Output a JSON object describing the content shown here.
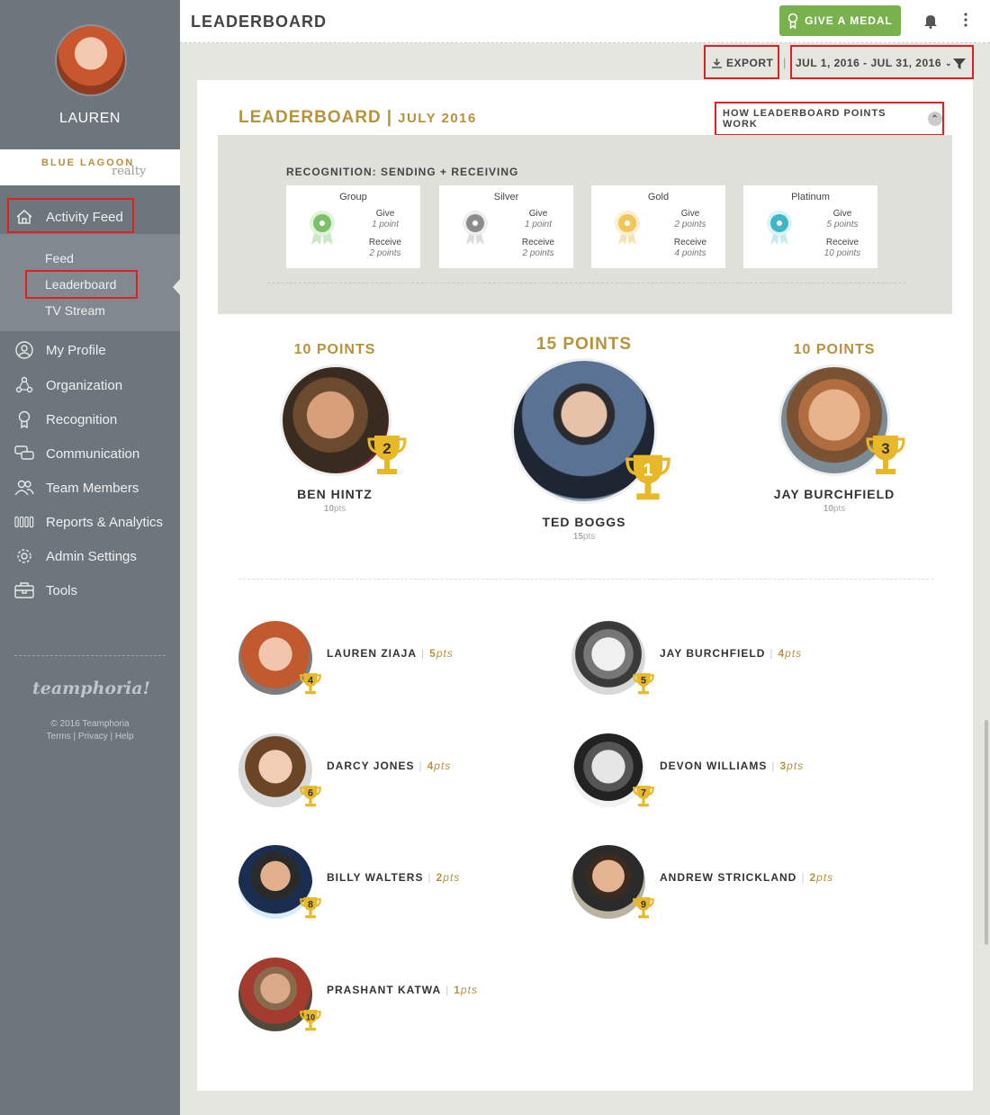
{
  "user": {
    "name": "LAUREN"
  },
  "brand": {
    "line1": "BLUE LAGOON",
    "line2": "realty"
  },
  "nav": {
    "activity_feed": "Activity Feed",
    "sub": [
      "Feed",
      "Leaderboard",
      "TV Stream"
    ],
    "items": [
      "My Profile",
      "Organization",
      "Recognition",
      "Communication",
      "Team Members",
      "Reports & Analytics",
      "Admin Settings",
      "Tools"
    ]
  },
  "footer": {
    "logo": "teamphoria!",
    "copyright": "© 2016 Teamphoria",
    "links": "Terms | Privacy | Help"
  },
  "header": {
    "title": "LEADERBOARD",
    "give_medal": "GIVE A MEDAL"
  },
  "toolbar": {
    "export": "EXPORT",
    "date_range": "JUL 1, 2016 - JUL 31, 2016"
  },
  "leaderboard": {
    "title": "LEADERBOARD",
    "month": "JULY 2016",
    "how_it_works": "HOW LEADERBOARD POINTS WORK",
    "recognition_title": "RECOGNITION: SENDING + RECEIVING",
    "medals": [
      {
        "name": "Group",
        "give_label": "Give",
        "give_points": "1 point",
        "receive_label": "Receive",
        "receive_points": "2 points",
        "color": "#7cc06a"
      },
      {
        "name": "Silver",
        "give_label": "Give",
        "give_points": "1 point",
        "receive_label": "Receive",
        "receive_points": "2 points",
        "color": "#8c8c8c"
      },
      {
        "name": "Gold",
        "give_label": "Give",
        "give_points": "2 points",
        "receive_label": "Receive",
        "receive_points": "4 points",
        "color": "#f0c55a"
      },
      {
        "name": "Platinum",
        "give_label": "Give",
        "give_points": "5 points",
        "receive_label": "Receive",
        "receive_points": "10 points",
        "color": "#3fb6c4"
      }
    ],
    "podium": [
      {
        "rank": "2",
        "points_label": "10 POINTS",
        "name": "BEN HINTZ",
        "pts_num": "10",
        "pts_unit": "pts"
      },
      {
        "rank": "1",
        "points_label": "15 POINTS",
        "name": "TED BOGGS",
        "pts_num": "15",
        "pts_unit": "pts"
      },
      {
        "rank": "3",
        "points_label": "10 POINTS",
        "name": "JAY BURCHFIELD",
        "pts_num": "10",
        "pts_unit": "pts"
      }
    ],
    "rows": [
      {
        "rank": "4",
        "name": "LAUREN ZIAJA",
        "pts_num": "5",
        "pts_unit": "pts"
      },
      {
        "rank": "5",
        "name": "JAY BURCHFIELD",
        "pts_num": "4",
        "pts_unit": "pts"
      },
      {
        "rank": "6",
        "name": "DARCY JONES",
        "pts_num": "4",
        "pts_unit": "pts"
      },
      {
        "rank": "7",
        "name": "DEVON WILLIAMS",
        "pts_num": "3",
        "pts_unit": "pts"
      },
      {
        "rank": "8",
        "name": "BILLY WALTERS",
        "pts_num": "2",
        "pts_unit": "pts"
      },
      {
        "rank": "9",
        "name": "ANDREW STRICKLAND",
        "pts_num": "2",
        "pts_unit": "pts"
      },
      {
        "rank": "10",
        "name": "PRASHANT KATWA",
        "pts_num": "1",
        "pts_unit": "pts"
      }
    ]
  },
  "colors": {
    "accent": "#b8923b",
    "green": "#79b14f",
    "sidebar": "#6d757d",
    "highlight": "#e02020"
  }
}
